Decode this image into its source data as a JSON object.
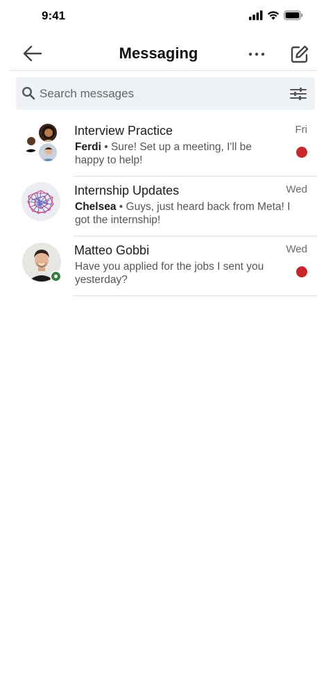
{
  "status_bar": {
    "time": "9:41"
  },
  "header": {
    "title": "Messaging",
    "back_icon": "arrow-left-icon",
    "more_icon": "more-horizontal-icon",
    "compose_icon": "compose-icon"
  },
  "search": {
    "placeholder": "Search messages",
    "value": "",
    "icon": "search-icon",
    "filter_icon": "filter-sliders-icon"
  },
  "conversations": [
    {
      "name": "Interview Practice",
      "time": "Fri",
      "sender": "Ferdi",
      "separator": "•",
      "preview": "Sure! Set up a meeting, I'll be happy to help!",
      "unread": true,
      "avatar": "group-avatar"
    },
    {
      "name": "Internship Updates",
      "time": "Wed",
      "sender": "Chelsea",
      "separator": "•",
      "preview": "Guys, just heard back from Meta! I got the internship!",
      "unread": false,
      "avatar": "network-graph-avatar"
    },
    {
      "name": "Matteo Gobbi",
      "time": "Wed",
      "sender": "",
      "separator": "",
      "preview": "Have you applied for the jobs I sent you yesterday?",
      "unread": true,
      "online": true,
      "avatar": "person-avatar"
    }
  ],
  "colors": {
    "unread": "#c8282c",
    "online": "#3a7d44",
    "search_bg": "#eef2f7",
    "divider": "#dedede"
  }
}
